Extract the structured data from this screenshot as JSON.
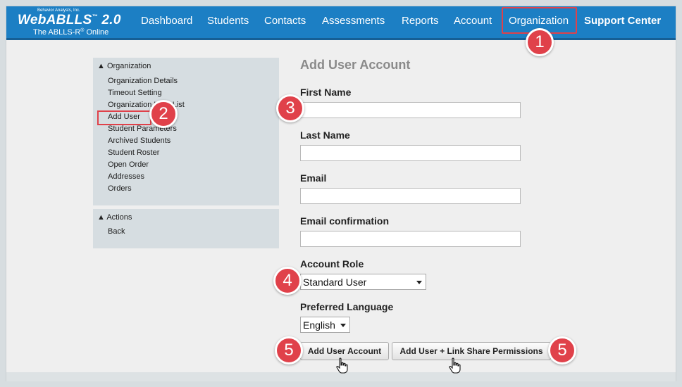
{
  "header": {
    "logo": {
      "tiny": "Behavior Analysts, Inc.",
      "brand": "WebABLLS",
      "tm": "™",
      "version": "2.0",
      "subtitle": "The ABLLS-R",
      "reg": "®",
      "subtitle_suffix": " Online"
    },
    "nav": [
      {
        "label": "Dashboard"
      },
      {
        "label": "Students"
      },
      {
        "label": "Contacts"
      },
      {
        "label": "Assessments"
      },
      {
        "label": "Reports"
      },
      {
        "label": "Account"
      },
      {
        "label": "Organization"
      },
      {
        "label": "Support Center"
      }
    ]
  },
  "sidebar": {
    "organization": {
      "heading": "▲ Organization",
      "items": [
        {
          "label": "Organization Details"
        },
        {
          "label": "Timeout Setting"
        },
        {
          "label": "Organization User List"
        },
        {
          "label": "Add User"
        },
        {
          "label": "Student Parameters"
        },
        {
          "label": "Archived Students"
        },
        {
          "label": "Student Roster"
        },
        {
          "label": "Open Order"
        },
        {
          "label": "Addresses"
        },
        {
          "label": "Orders"
        }
      ]
    },
    "actions": {
      "heading": "▲ Actions",
      "items": [
        {
          "label": "Back"
        }
      ]
    }
  },
  "form": {
    "title": "Add User Account",
    "first_name": {
      "label": "First Name",
      "value": ""
    },
    "last_name": {
      "label": "Last Name",
      "value": ""
    },
    "email": {
      "label": "Email",
      "value": ""
    },
    "email_confirmation": {
      "label": "Email confirmation",
      "value": ""
    },
    "account_role": {
      "label": "Account Role",
      "selected": "Standard User"
    },
    "preferred_language": {
      "label": "Preferred Language",
      "selected": "English"
    },
    "buttons": {
      "add_user": "Add User Account",
      "add_user_link": "Add User + Link Share Permissions"
    }
  },
  "callouts": [
    "1",
    "2",
    "3",
    "4",
    "5",
    "5"
  ],
  "colors": {
    "header_blue": "#1c7fc4",
    "callout_red": "#e0414a",
    "sidebar_bg": "#d6dde1"
  }
}
